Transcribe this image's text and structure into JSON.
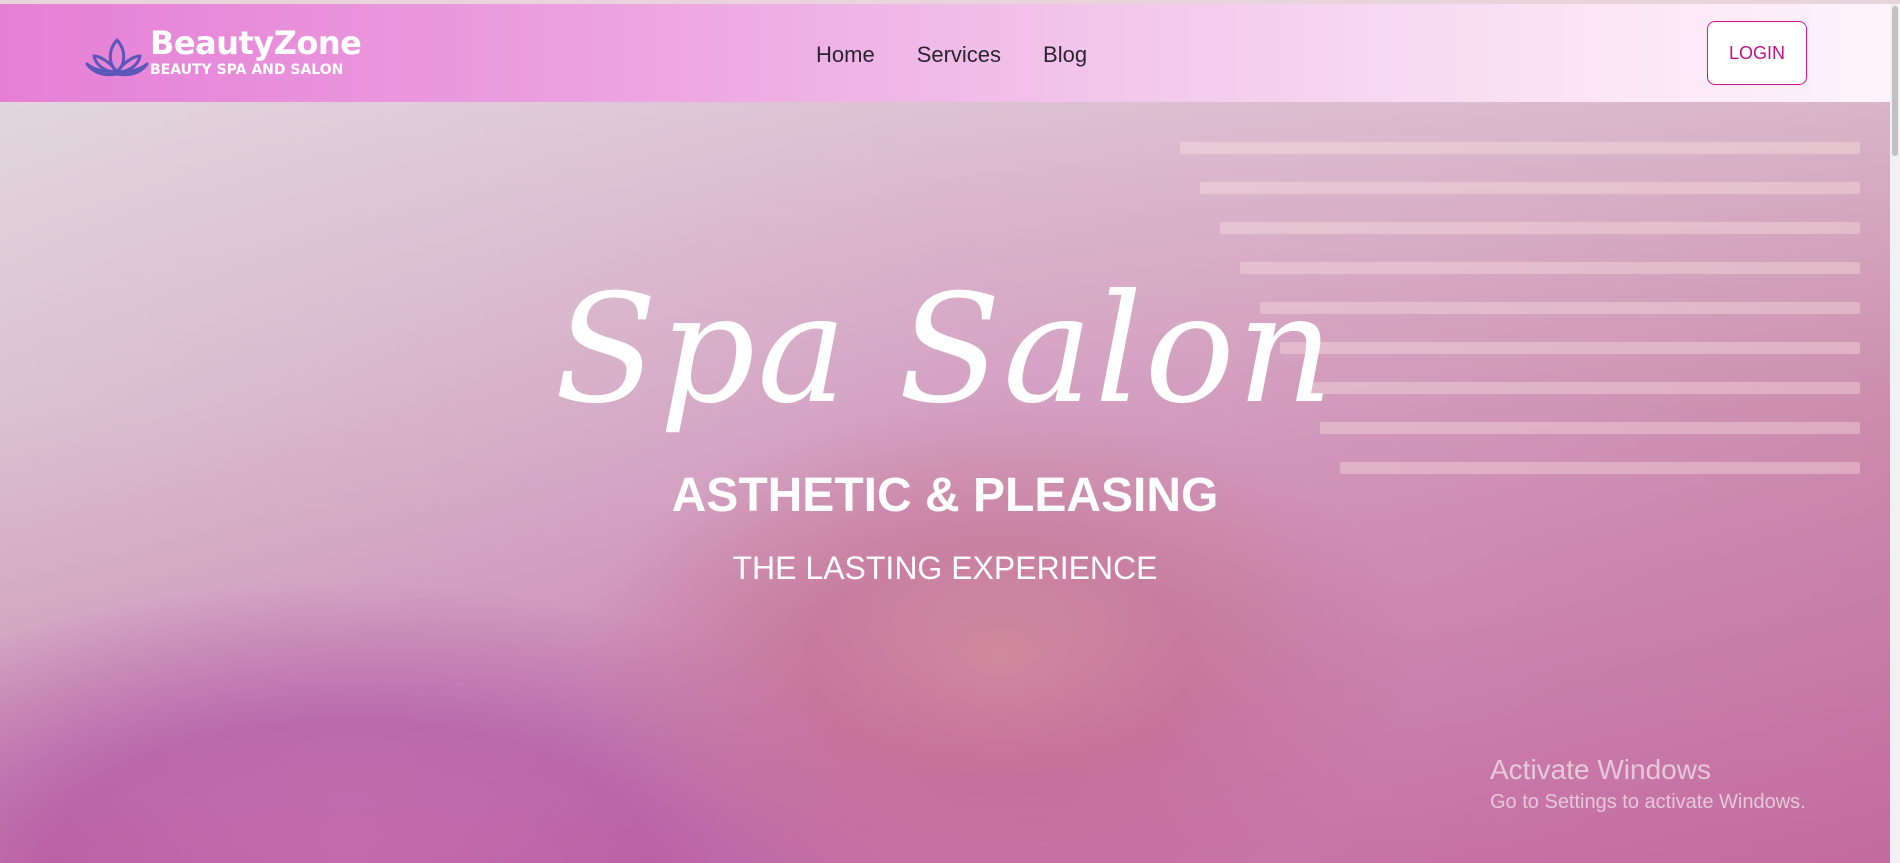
{
  "navbar": {
    "brand_name": "BeautyZone",
    "brand_sub": "BEAUTY SPA AND SALON",
    "logo_icon": "lotus-icon",
    "links": [
      {
        "label": "Home"
      },
      {
        "label": "Services"
      },
      {
        "label": "Blog"
      }
    ],
    "login_label": "LOGIN"
  },
  "hero": {
    "title": "Spa Salon",
    "subtitle": "ASTHETIC & PLEASING",
    "tagline": "THE LASTING EXPERIENCE"
  },
  "watermark": {
    "title": "Activate Windows",
    "subtitle": "Go to Settings to activate Windows."
  },
  "colors": {
    "brand_pink": "#e57fd6",
    "login_accent": "#c4108f",
    "logo_purple": "#5a57b8"
  }
}
